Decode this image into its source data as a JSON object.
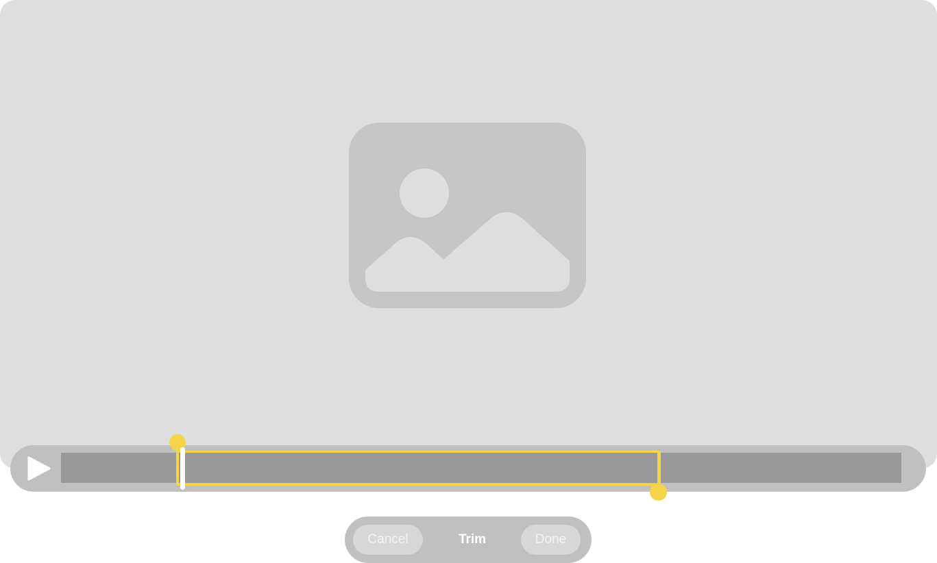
{
  "preview": {
    "placeholder_icon": "image-placeholder-icon"
  },
  "timeline": {
    "play_icon": "play-icon"
  },
  "toolbar": {
    "cancel_label": "Cancel",
    "title": "Trim",
    "done_label": "Done"
  },
  "colors": {
    "preview_bg": "#dedede",
    "bar_bg": "#c0c0c0",
    "track": "#999999",
    "accent": "#f6d44a",
    "playhead": "#ffffff"
  }
}
